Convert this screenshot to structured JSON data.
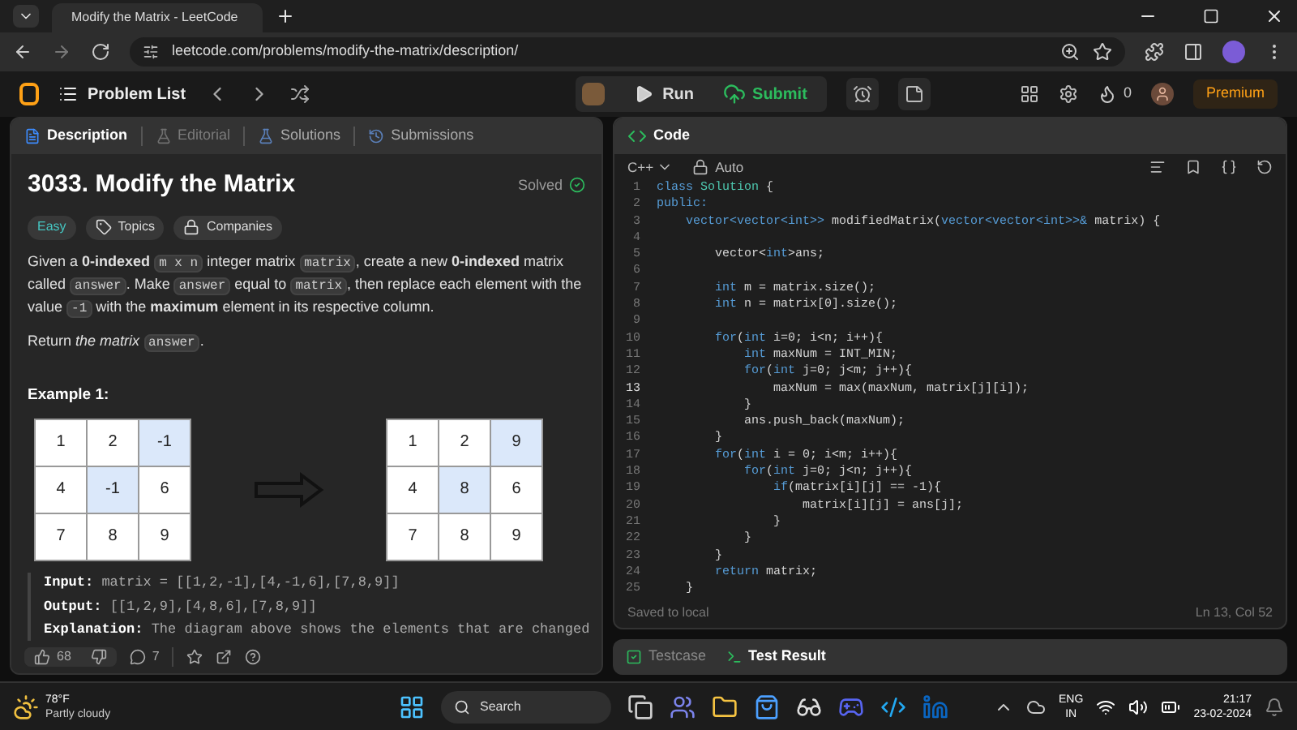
{
  "browser": {
    "tab_title": "Modify the Matrix - LeetCode",
    "url": "leetcode.com/problems/modify-the-matrix/description/"
  },
  "nav": {
    "problem_list": "Problem List",
    "run": "Run",
    "submit": "Submit",
    "streak": "0",
    "premium": "Premium"
  },
  "left_tabs": [
    {
      "label": "Description",
      "selected": true,
      "disabled": false
    },
    {
      "label": "Editorial",
      "selected": false,
      "disabled": true
    },
    {
      "label": "Solutions",
      "selected": false,
      "disabled": false
    },
    {
      "label": "Submissions",
      "selected": false,
      "disabled": false
    }
  ],
  "problem": {
    "title": "3033. Modify the Matrix",
    "status": "Solved",
    "tags": [
      {
        "label": "Easy",
        "kind": "difficulty"
      },
      {
        "label": "Topics",
        "kind": "topics"
      },
      {
        "label": "Companies",
        "kind": "companies"
      }
    ],
    "description": [
      {
        "kind": "text",
        "text": "Given a **0-indexed** "
      },
      {
        "kind": "code",
        "text": "m x n"
      },
      {
        "kind": "text",
        "text": " integer matrix "
      },
      {
        "kind": "code",
        "text": "matrix"
      },
      {
        "kind": "text",
        "text": ", create a new **0-indexed** matrix called "
      },
      {
        "kind": "code",
        "text": "answer"
      },
      {
        "kind": "text",
        "text": ". Make "
      },
      {
        "kind": "code",
        "text": "answer"
      },
      {
        "kind": "text",
        "text": " equal to "
      },
      {
        "kind": "code",
        "text": "matrix"
      },
      {
        "kind": "text",
        "text": ", then replace each element with the value "
      },
      {
        "kind": "code",
        "text": "-1"
      },
      {
        "kind": "text",
        "text": " with the **maximum** element in its respective column."
      }
    ],
    "return_line": [
      {
        "kind": "text",
        "text": "Return *the matrix* "
      },
      {
        "kind": "code",
        "text": "answer"
      },
      {
        "kind": "text",
        "text": "."
      }
    ],
    "example_title": "Example 1:",
    "matrices": [
      {
        "rows": [
          [
            {
              "value": "1",
              "highlighted": false
            },
            {
              "value": "2",
              "highlighted": false
            },
            {
              "value": "-1",
              "highlighted": true
            }
          ],
          [
            {
              "value": "4",
              "highlighted": false
            },
            {
              "value": "-1",
              "highlighted": true
            },
            {
              "value": "6",
              "highlighted": false
            }
          ],
          [
            {
              "value": "7",
              "highlighted": false
            },
            {
              "value": "8",
              "highlighted": false
            },
            {
              "value": "9",
              "highlighted": false
            }
          ]
        ]
      },
      {
        "rows": [
          [
            {
              "value": "1",
              "highlighted": false
            },
            {
              "value": "2",
              "highlighted": false
            },
            {
              "value": "9",
              "highlighted": true
            }
          ],
          [
            {
              "value": "4",
              "highlighted": false
            },
            {
              "value": "8",
              "highlighted": true
            },
            {
              "value": "6",
              "highlighted": false
            }
          ],
          [
            {
              "value": "7",
              "highlighted": false
            },
            {
              "value": "8",
              "highlighted": false
            },
            {
              "value": "9",
              "highlighted": false
            }
          ]
        ]
      }
    ],
    "example_lines": [
      "**Input:** matrix = [[1,2,-1],[4,-1,6],[7,8,9]]",
      "**Output:** [[1,2,9],[4,8,6],[7,8,9]]",
      "**Explanation:** The diagram above shows the elements that are changed"
    ]
  },
  "footer": {
    "likes": "68",
    "comments": "7"
  },
  "code_panel": {
    "title": "Code",
    "language": "C++",
    "mode": "Auto",
    "status": "Saved to local",
    "cursor": "Ln 13, Col 52",
    "lines": [
      {
        "number": "1",
        "current": false,
        "segments": [
          {
            "kind": "kw",
            "text": "class"
          },
          {
            "kind": "var",
            "text": " Solution"
          },
          {
            "kind": "plain",
            "text": " {"
          }
        ]
      },
      {
        "number": "2",
        "current": false,
        "segments": [
          {
            "kind": "kw",
            "text": "public:"
          }
        ]
      },
      {
        "number": "3",
        "current": false,
        "segments": [
          {
            "kind": "kw",
            "text": "    vector<vector<int>>"
          },
          {
            "kind": "plain",
            "text": " modifiedMatrix("
          },
          {
            "kind": "kw",
            "text": "vector<vector<int>>&"
          },
          {
            "kind": "plain",
            "text": " matrix) {"
          }
        ]
      },
      {
        "number": "4",
        "current": false
      },
      {
        "number": "5",
        "current": false,
        "segments": [
          {
            "kind": "plain",
            "text": "        vector<"
          },
          {
            "kind": "kw",
            "text": "int"
          },
          {
            "kind": "plain",
            "text": ">ans;"
          }
        ]
      },
      {
        "number": "6",
        "current": false
      },
      {
        "number": "7",
        "current": false,
        "segments": [
          {
            "kind": "kw",
            "text": "        int"
          },
          {
            "kind": "plain",
            "text": " m = matrix.size();"
          }
        ]
      },
      {
        "number": "8",
        "current": false,
        "segments": [
          {
            "kind": "kw",
            "text": "        int"
          },
          {
            "kind": "plain",
            "text": " n = matrix[0].size();"
          }
        ]
      },
      {
        "number": "9",
        "current": false
      },
      {
        "number": "10",
        "current": false,
        "segments": [
          {
            "kind": "kw",
            "text": "        for"
          },
          {
            "kind": "plain",
            "text": "("
          },
          {
            "kind": "kw",
            "text": "int"
          },
          {
            "kind": "plain",
            "text": " i=0; i<n; i++){"
          }
        ]
      },
      {
        "number": "11",
        "current": false,
        "segments": [
          {
            "kind": "kw",
            "text": "            int"
          },
          {
            "kind": "plain",
            "text": " maxNum = INT_MIN;"
          }
        ]
      },
      {
        "number": "12",
        "current": false,
        "segments": [
          {
            "kind": "kw",
            "text": "            for"
          },
          {
            "kind": "plain",
            "text": "("
          },
          {
            "kind": "kw",
            "text": "int"
          },
          {
            "kind": "plain",
            "text": " j=0; j<m; j++){"
          }
        ]
      },
      {
        "number": "13",
        "current": true,
        "segments": [
          {
            "kind": "plain",
            "text": "                maxNum = max(maxNum, matrix[j][i]);"
          }
        ]
      },
      {
        "number": "14",
        "current": false,
        "segments": [
          {
            "kind": "plain",
            "text": "            }"
          }
        ]
      },
      {
        "number": "15",
        "current": false,
        "segments": [
          {
            "kind": "plain",
            "text": "            ans.push_back(maxNum);"
          }
        ]
      },
      {
        "number": "16",
        "current": false,
        "segments": [
          {
            "kind": "plain",
            "text": "        }"
          }
        ]
      },
      {
        "number": "17",
        "current": false,
        "segments": [
          {
            "kind": "kw",
            "text": "        for"
          },
          {
            "kind": "plain",
            "text": "("
          },
          {
            "kind": "kw",
            "text": "int"
          },
          {
            "kind": "plain",
            "text": " i = 0; i<m; i++){"
          }
        ]
      },
      {
        "number": "18",
        "current": false,
        "segments": [
          {
            "kind": "kw",
            "text": "            for"
          },
          {
            "kind": "plain",
            "text": "("
          },
          {
            "kind": "kw",
            "text": "int"
          },
          {
            "kind": "plain",
            "text": " j=0; j<n; j++){"
          }
        ]
      },
      {
        "number": "19",
        "current": false,
        "segments": [
          {
            "kind": "kw",
            "text": "                if"
          },
          {
            "kind": "plain",
            "text": "(matrix[i][j] == -1){"
          }
        ]
      },
      {
        "number": "20",
        "current": false,
        "segments": [
          {
            "kind": "plain",
            "text": "                    matrix[i][j] = ans[j];"
          }
        ]
      },
      {
        "number": "21",
        "current": false,
        "segments": [
          {
            "kind": "plain",
            "text": "                }"
          }
        ]
      },
      {
        "number": "22",
        "current": false,
        "segments": [
          {
            "kind": "plain",
            "text": "            }"
          }
        ]
      },
      {
        "number": "23",
        "current": false,
        "segments": [
          {
            "kind": "plain",
            "text": "        }"
          }
        ]
      },
      {
        "number": "24",
        "current": false,
        "segments": [
          {
            "kind": "kw",
            "text": "        return"
          },
          {
            "kind": "plain",
            "text": " matrix;"
          }
        ]
      },
      {
        "number": "25",
        "current": false,
        "segments": [
          {
            "kind": "plain",
            "text": "    }"
          }
        ]
      }
    ]
  },
  "bottom_tabs": [
    {
      "label": "Testcase",
      "selected": false
    },
    {
      "label": "Test Result",
      "selected": true
    }
  ],
  "taskbar": {
    "temperature": "78°F",
    "weather": "Partly cloudy",
    "search": "Search",
    "language": "ENG",
    "region": "IN",
    "time": "21:17",
    "date": "23-02-2024"
  }
}
